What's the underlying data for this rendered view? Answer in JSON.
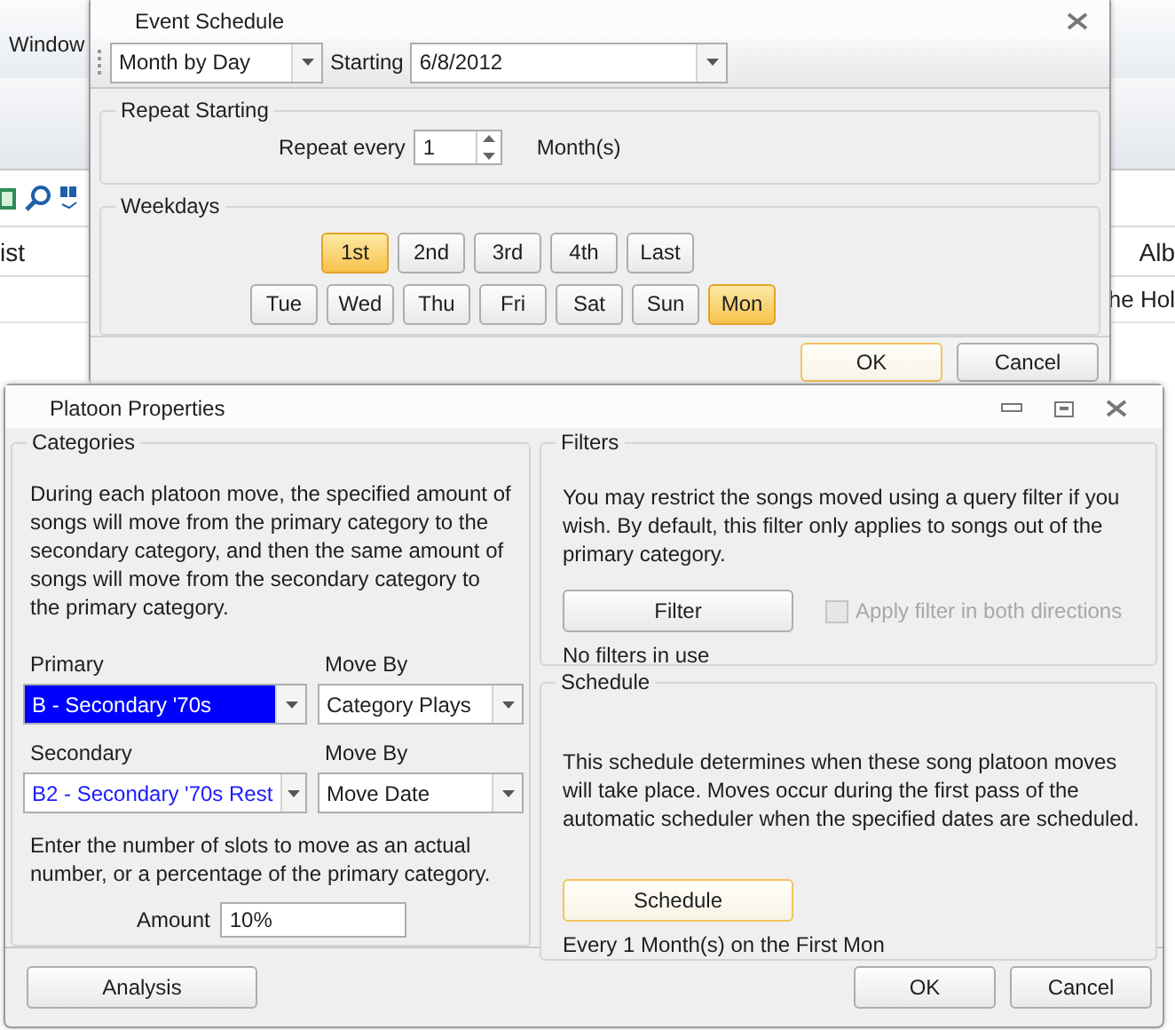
{
  "background": {
    "menu_item": "Window",
    "columns": [
      "ist",
      "Alb"
    ],
    "cell": "he Hol"
  },
  "event_schedule": {
    "title": "Event Schedule",
    "mode": "Month by Day",
    "starting": {
      "label": "Starting",
      "value": "6/8/2012"
    },
    "repeat": {
      "title": "Repeat Starting",
      "label": "Repeat every",
      "value": "1",
      "unit": "Month(s)"
    },
    "weekdays": {
      "title": "Weekdays",
      "ordinals": [
        {
          "label": "1st",
          "selected": true
        },
        {
          "label": "2nd",
          "selected": false
        },
        {
          "label": "3rd",
          "selected": false
        },
        {
          "label": "4th",
          "selected": false
        },
        {
          "label": "Last",
          "selected": false
        }
      ],
      "days": [
        {
          "label": "Tue",
          "selected": false
        },
        {
          "label": "Wed",
          "selected": false
        },
        {
          "label": "Thu",
          "selected": false
        },
        {
          "label": "Fri",
          "selected": false
        },
        {
          "label": "Sat",
          "selected": false
        },
        {
          "label": "Sun",
          "selected": false
        },
        {
          "label": "Mon",
          "selected": true
        }
      ]
    },
    "buttons": [
      {
        "label": "OK",
        "focused": true
      },
      {
        "label": "Cancel",
        "focused": false
      }
    ]
  },
  "platoon_properties": {
    "title": "Platoon Properties",
    "categories": {
      "title": "Categories",
      "description": "During each platoon move, the specified amount of songs will move from the primary category to the secondary category, and then the same amount of songs will move from the secondary category to the primary category.",
      "fields": [
        {
          "label": "Primary",
          "value": "B - Secondary '70s",
          "kind": "highlighted"
        },
        {
          "label": "Move By",
          "value": "Category Plays",
          "kind": "plain"
        },
        {
          "label": "Secondary",
          "value": "B2 - Secondary '70s Rest",
          "kind": "category"
        },
        {
          "label": "Move By",
          "value": "Move Date",
          "kind": "plain"
        }
      ],
      "amount_hint": "Enter the number of slots to move as an actual number, or a percentage of the primary category.",
      "amount": {
        "label": "Amount",
        "value": "10%"
      }
    },
    "filters": {
      "title": "Filters",
      "description": "You may restrict the songs moved using a query filter if you wish. By default, this filter only applies to songs out of the primary category.",
      "button": "Filter",
      "checkbox": {
        "label": "Apply filter in both directions",
        "checked": false,
        "disabled": true
      },
      "status": "No filters in use"
    },
    "schedule": {
      "title": "Schedule",
      "description": "This schedule determines when these song platoon moves will take place. Moves occur during the first pass of the automatic scheduler when the specified dates are scheduled.",
      "button": {
        "label": "Schedule",
        "focused": true
      },
      "status": "Every 1 Month(s) on the First Mon"
    },
    "buttons": [
      {
        "label": "Analysis"
      },
      {
        "label": "OK"
      },
      {
        "label": "Cancel"
      }
    ]
  }
}
